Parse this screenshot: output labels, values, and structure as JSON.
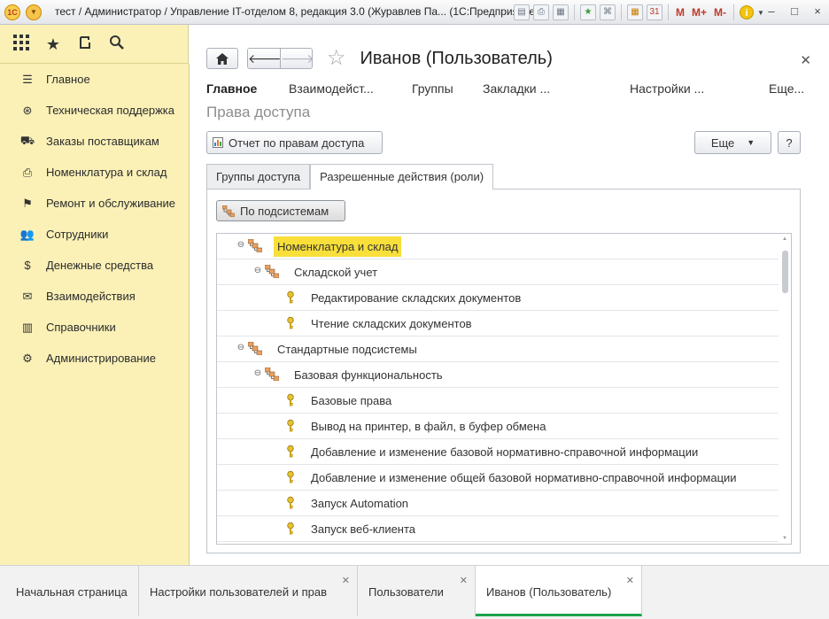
{
  "titlebar": {
    "title": "тест / Администратор / Управление IT-отделом 8, редакция 3.0 (Журавлев Па...  (1С:Предприятие)",
    "logo_text": "1С",
    "m_labels": [
      "M",
      "M+",
      "M-"
    ],
    "info_label": "i",
    "window_buttons": [
      "–",
      "□",
      "×"
    ]
  },
  "toolbar": {
    "icons": [
      "apps-grid-icon",
      "favorites-star-icon",
      "history-icon",
      "search-icon"
    ]
  },
  "sidebar": {
    "items": [
      {
        "label": "Главное",
        "icon": "menu-lines-icon"
      },
      {
        "label": "Техническая поддержка",
        "icon": "lifebuoy-icon"
      },
      {
        "label": "Заказы поставщикам",
        "icon": "truck-icon"
      },
      {
        "label": "Номенклатура и склад",
        "icon": "printer-icon"
      },
      {
        "label": "Ремонт и обслуживание",
        "icon": "checkered-flag-icon"
      },
      {
        "label": "Сотрудники",
        "icon": "people-icon"
      },
      {
        "label": "Денежные средства",
        "icon": "money-bag-icon"
      },
      {
        "label": "Взаимодействия",
        "icon": "envelope-icon"
      },
      {
        "label": "Справочники",
        "icon": "books-icon"
      },
      {
        "label": "Администрирование",
        "icon": "gear-icon"
      }
    ]
  },
  "form": {
    "title": "Иванов (Пользователь)",
    "sections": [
      "Главное",
      "Взаимодейст...",
      "Группы",
      "Закладки ...",
      "Настройки ...",
      "Еще..."
    ],
    "page_title": "Права доступа",
    "report_button": "Отчет по правам доступа",
    "more_button": "Еще",
    "help_button": "?",
    "tabs": [
      "Группы доступа",
      "Разрешенные действия (роли)"
    ],
    "subsystems_button": "По подсистемам"
  },
  "tree": {
    "rows": [
      {
        "label": "Номенклатура и склад",
        "level": 0,
        "type": "group",
        "highlighted": true
      },
      {
        "label": "Складской учет",
        "level": 1,
        "type": "group",
        "highlighted": false
      },
      {
        "label": "Редактирование складских документов",
        "level": 2,
        "type": "role",
        "highlighted": false
      },
      {
        "label": "Чтение складских документов",
        "level": 2,
        "type": "role",
        "highlighted": false
      },
      {
        "label": "Стандартные подсистемы",
        "level": 0,
        "type": "group",
        "highlighted": false
      },
      {
        "label": "Базовая функциональность",
        "level": 1,
        "type": "group",
        "highlighted": false
      },
      {
        "label": "Базовые права",
        "level": 2,
        "type": "role",
        "highlighted": false
      },
      {
        "label": "Вывод на принтер, в файл, в буфер обмена",
        "level": 2,
        "type": "role",
        "highlighted": false
      },
      {
        "label": "Добавление и изменение базовой нормативно-справочной информации",
        "level": 2,
        "type": "role",
        "highlighted": false
      },
      {
        "label": "Добавление и изменение общей базовой нормативно-справочной информации",
        "level": 2,
        "type": "role",
        "highlighted": false
      },
      {
        "label": "Запуск Automation",
        "level": 2,
        "type": "role",
        "highlighted": false
      },
      {
        "label": "Запуск веб-клиента",
        "level": 2,
        "type": "role",
        "highlighted": false
      }
    ]
  },
  "bottom_tabs": [
    {
      "label": "Начальная страница",
      "closable": false,
      "active": false
    },
    {
      "label": "Настройки пользователей и прав",
      "closable": true,
      "active": false
    },
    {
      "label": "Пользователи",
      "closable": true,
      "active": false
    },
    {
      "label": "Иванов (Пользователь)",
      "closable": true,
      "active": true
    }
  ],
  "colors": {
    "sidebar_bg": "#fbf1b7",
    "highlight": "#f8df3a",
    "active_tab_underline": "#1aa34a"
  }
}
